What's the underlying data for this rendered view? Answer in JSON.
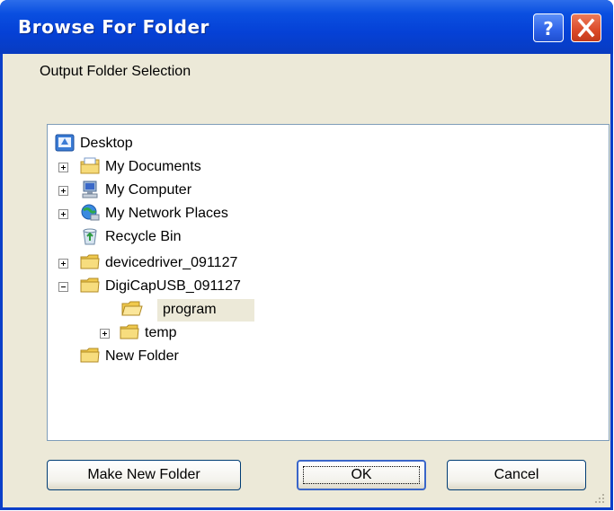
{
  "window": {
    "title": "Browse For Folder",
    "help_icon": "help-icon",
    "close_icon": "close-icon"
  },
  "caption": "Output Folder Selection",
  "tree": {
    "items": [
      {
        "label": "Desktop",
        "icon": "desktop-icon"
      },
      {
        "label": "My Documents",
        "icon": "documents-icon",
        "expander": "+"
      },
      {
        "label": "My Computer",
        "icon": "computer-icon",
        "expander": "+"
      },
      {
        "label": "My Network Places",
        "icon": "network-icon",
        "expander": "+"
      },
      {
        "label": "Recycle Bin",
        "icon": "recycle-bin-icon"
      },
      {
        "label": "devicedriver_091127",
        "icon": "folder-icon",
        "expander": "+"
      },
      {
        "label": "DigiCapUSB_091127",
        "icon": "folder-icon",
        "expander": "-"
      },
      {
        "label": "program",
        "icon": "folder-open-icon",
        "selected": true
      },
      {
        "label": "temp",
        "icon": "folder-icon",
        "expander": "+"
      },
      {
        "label": "New Folder",
        "icon": "folder-icon"
      }
    ]
  },
  "buttons": {
    "make_new_folder": "Make New Folder",
    "ok": "OK",
    "cancel": "Cancel"
  },
  "colors": {
    "titlebar": "#0541d6",
    "dialog_face": "#ece9d8",
    "close_button": "#db4a28"
  }
}
